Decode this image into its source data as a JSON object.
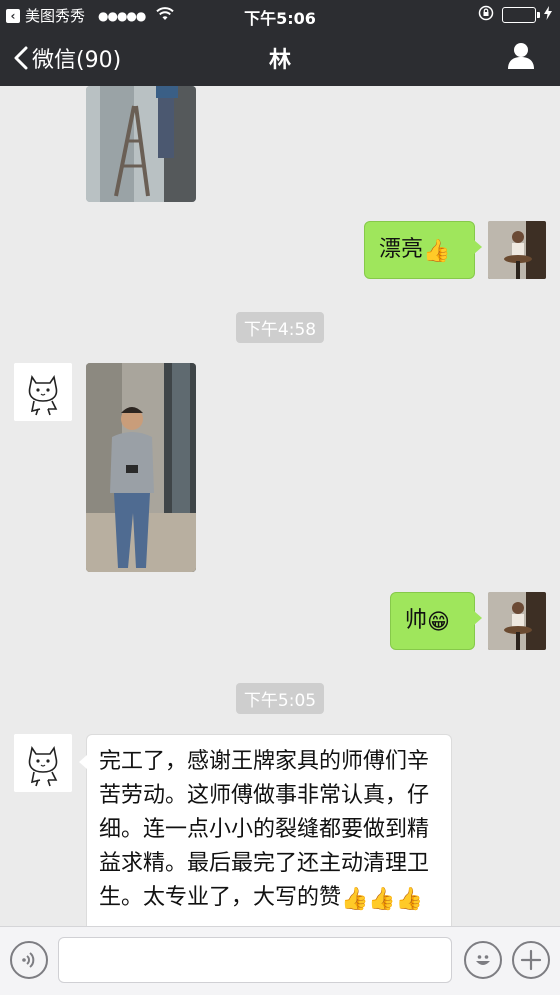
{
  "status_bar": {
    "back_app": "美图秀秀",
    "signal": "●●●●●",
    "time": "下午5:06",
    "battery_level": 0.85
  },
  "nav": {
    "back_label": "微信(90)",
    "title": "林"
  },
  "messages": {
    "msg_praise": "漂亮",
    "msg_handsome": "帅",
    "msg_long": "完工了，感谢王牌家具的师傅们辛苦劳动。这师傅做事非常认真，仔细。连一点小小的裂缝都要做到精益求精。最后最完了还主动清理卫生。太专业了，大写的赞"
  },
  "timestamps": {
    "t1": "下午4:58",
    "t2": "下午5:05"
  },
  "emoji": {
    "thumbs_up": "👍",
    "grin": "😁"
  },
  "input": {
    "value": "",
    "placeholder": ""
  },
  "colors": {
    "bar_bg": "#2c2d31",
    "chat_bg": "#ebebeb",
    "bubble_green": "#9fe65c",
    "timestamp_bg": "#cecece"
  },
  "icons": [
    "back-chevron-icon",
    "wifi-icon",
    "rotation-lock-icon",
    "battery-icon",
    "profile-icon",
    "voice-icon",
    "emoji-icon",
    "add-icon"
  ]
}
